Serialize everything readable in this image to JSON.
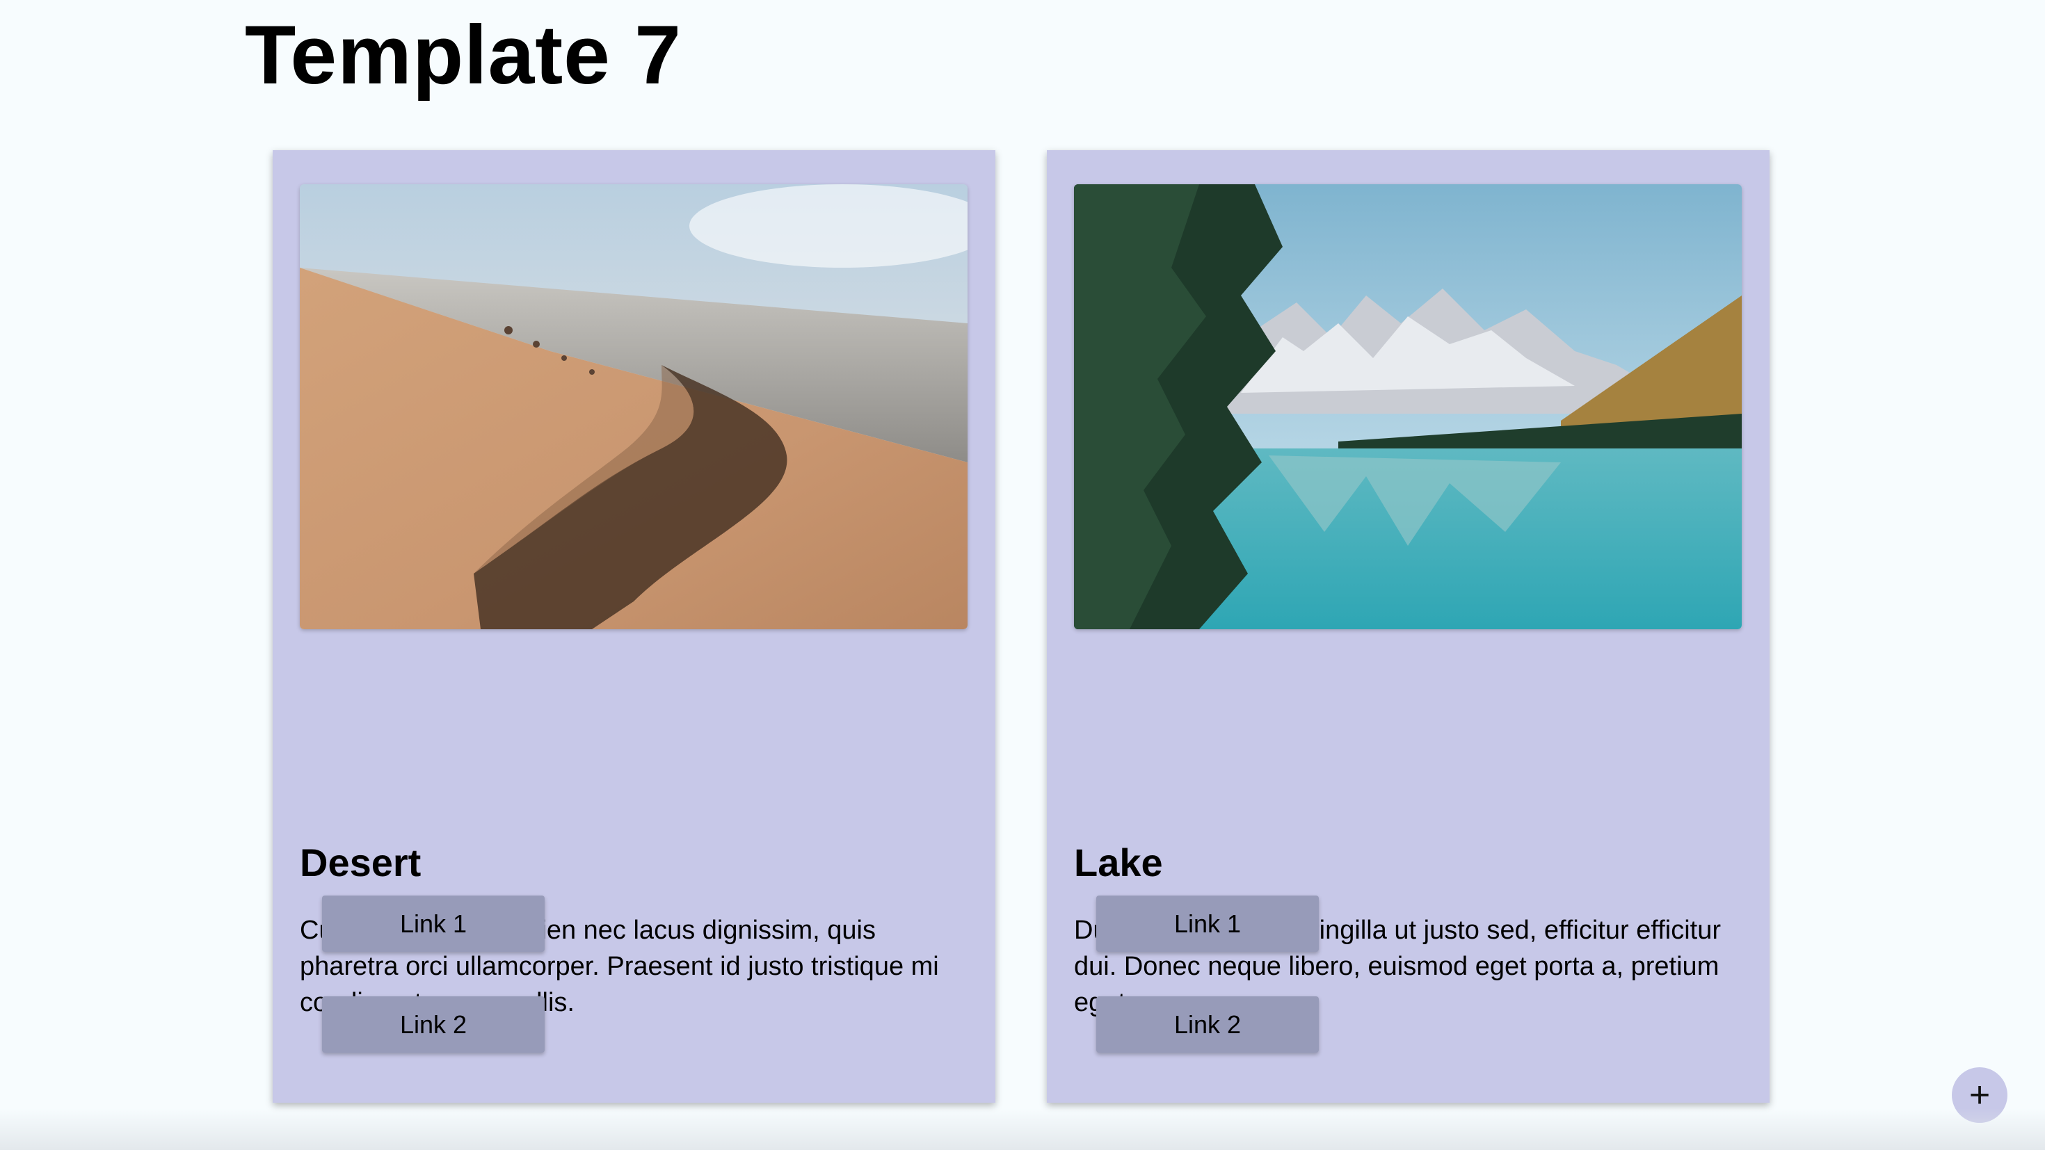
{
  "page": {
    "title": "Template 7"
  },
  "cards": [
    {
      "title": "Desert",
      "text": "Curabitur lacinia sapien nec lacus dignissim, quis pharetra orci ullamcorper. Praesent id justo tristique mi condimentum convallis.",
      "image_subject": "desert dunes by the sea",
      "links": [
        "Link 1",
        "Link 2"
      ]
    },
    {
      "title": "Lake",
      "text": "Duis lorem magna, fringilla ut justo sed, efficitur efficitur dui. Donec neque libero, euismod eget porta a, pretium eget purus.",
      "image_subject": "mountain lake with pine trees",
      "links": [
        "Link 1",
        "Link 2"
      ]
    }
  ],
  "fab": {
    "icon": "plus-icon",
    "label": "+"
  },
  "colors": {
    "background": "#f7fcfe",
    "card": "#c7c8e8",
    "button": "#979bb9"
  }
}
